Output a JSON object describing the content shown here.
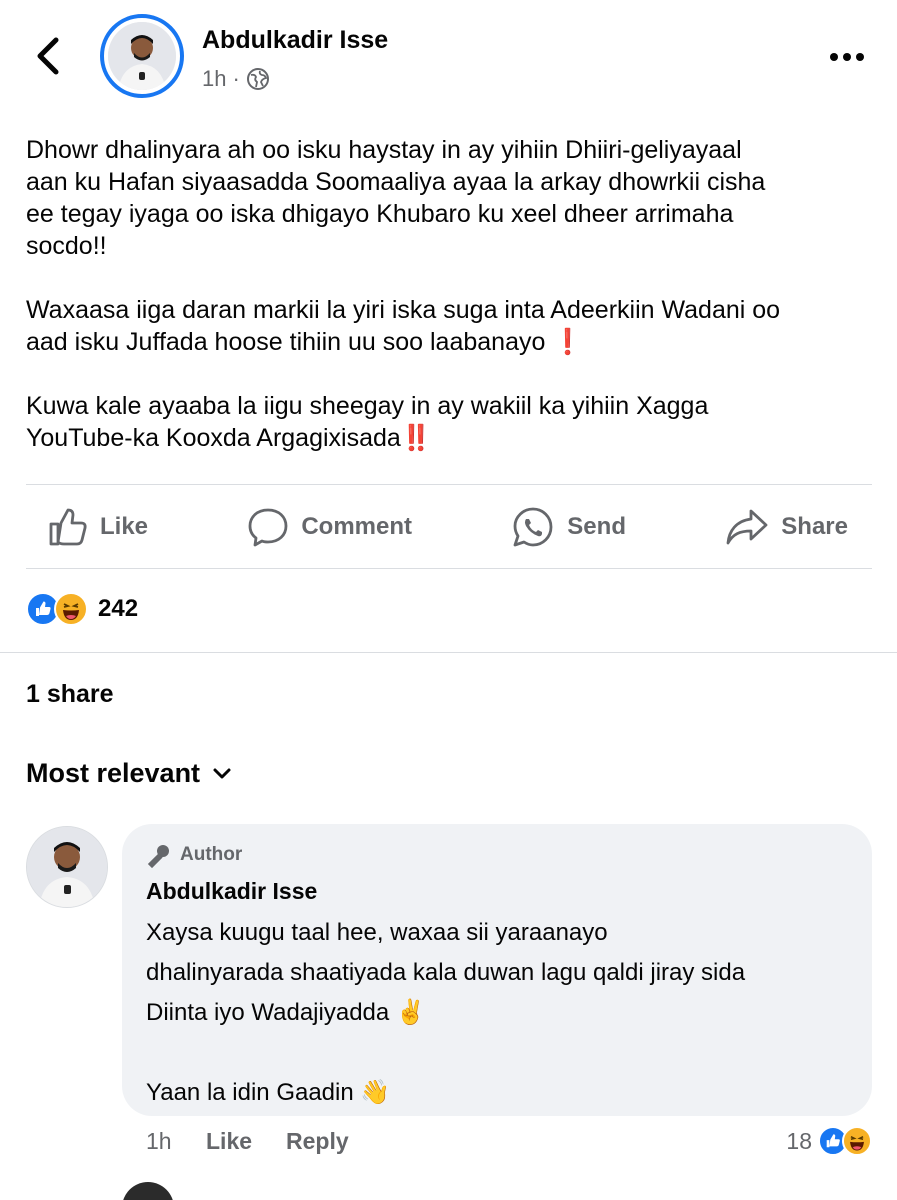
{
  "header": {
    "author_name": "Abdulkadir Isse",
    "time": "1h",
    "separator": "·",
    "back_icon": "chevron-left-icon",
    "more_icon": "more-horizontal-icon",
    "privacy_icon": "globe-icon"
  },
  "post": {
    "paragraph_1": "Dhowr dhalinyara ah oo isku haystay in ay yihiin Dhiiri-geliyayaal\naan ku Hafan siyaasadda Soomaaliya ayaa la arkay dhowrkii cisha\nee tegay iyaga oo iska dhigayo Khubaro ku xeel dheer arrimaha\nsocdo!!",
    "paragraph_2": "Waxaasa iiga daran markii la yiri iska suga inta Adeerkiin Wadani oo\naad isku Juffada hoose tihiin uu soo laabanayo",
    "paragraph_2_emoji": "❗",
    "paragraph_3": "Kuwa kale ayaaba la iigu sheegay in ay wakiil ka yihiin Xagga\nYouTube-ka Kooxda Argagixisada",
    "paragraph_3_emoji": "‼️"
  },
  "actions": {
    "like": "Like",
    "comment": "Comment",
    "send": "Send",
    "share": "Share"
  },
  "reactions": {
    "count": "242",
    "types": [
      "like",
      "haha"
    ],
    "like_color": "#1877f2",
    "haha_color": "#f7b125"
  },
  "shares": {
    "label": "1 share"
  },
  "comments_filter": {
    "label": "Most relevant"
  },
  "comment": {
    "badge": "Author",
    "name": "Abdulkadir Isse",
    "text": "Xaysa kuugu taal hee, waxaa sii yaraanayo\ndhalinyarada shaatiyada kala duwan lagu qaldi jiray sida\nDiinta iyo Wadajiyadda ✌️\n\nYaan la idin Gaadin 👋",
    "time": "1h",
    "like": "Like",
    "reply": "Reply",
    "reaction_count": "18"
  },
  "colors": {
    "accent": "#1877f2",
    "secondary_text": "#65676b",
    "bubble_bg": "#f0f2f5",
    "exclamation": "#e0202e"
  }
}
